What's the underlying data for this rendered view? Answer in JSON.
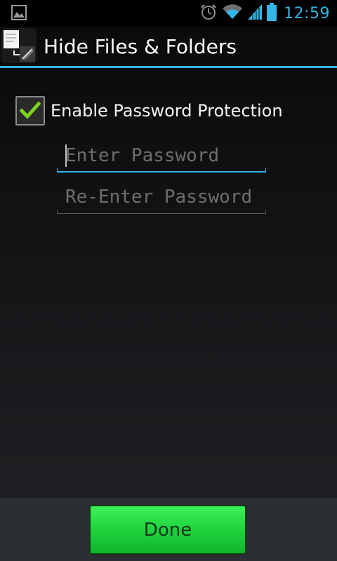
{
  "status_bar": {
    "time": "12:59",
    "icons": [
      "gallery-icon",
      "alarm-icon",
      "wifi-icon",
      "signal-icon",
      "battery-icon"
    ]
  },
  "action_bar": {
    "title": "Hide Files & Folders",
    "app_icon": "app-icon"
  },
  "form": {
    "checkbox_label": "Enable Password Protection",
    "checkbox_checked": true,
    "password_placeholder": "Enter Password",
    "password_value": "",
    "reenter_placeholder": "Re-Enter Password",
    "reenter_value": ""
  },
  "footer": {
    "done_label": "Done"
  },
  "colors": {
    "accent": "#33b5e5",
    "check": "#7ed321",
    "done_button": "#20d33e"
  }
}
